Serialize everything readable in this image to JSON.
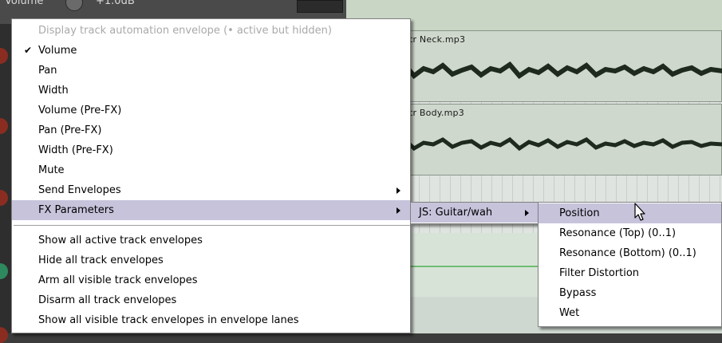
{
  "background": {
    "track": {
      "label": "Volume",
      "value": "+1.0dB"
    },
    "items": [
      {
        "name": "tr Neck.mp3"
      },
      {
        "name": "tr Body.mp3"
      }
    ]
  },
  "main_menu": {
    "header": "Display track automation envelope (• active but hidden)",
    "items": [
      {
        "label": "Volume",
        "checked": true
      },
      {
        "label": "Pan"
      },
      {
        "label": "Width"
      },
      {
        "label": "Volume (Pre-FX)"
      },
      {
        "label": "Pan (Pre-FX)"
      },
      {
        "label": "Width (Pre-FX)"
      },
      {
        "label": "Mute"
      },
      {
        "label": "Send Envelopes",
        "submenu": true
      },
      {
        "label": "FX Parameters",
        "submenu": true,
        "highlighted": true
      }
    ],
    "actions": [
      {
        "label": "Show all active track envelopes"
      },
      {
        "label": "Hide all track envelopes"
      },
      {
        "label": "Arm all visible track envelopes"
      },
      {
        "label": "Disarm all track envelopes"
      },
      {
        "label": "Show all visible track envelopes in envelope lanes"
      }
    ]
  },
  "fx_submenu": {
    "items": [
      {
        "label": "JS: Guitar/wah",
        "submenu": true
      }
    ]
  },
  "param_submenu": {
    "items": [
      {
        "label": "Position",
        "highlighted": true
      },
      {
        "label": "Resonance (Top) (0..1)"
      },
      {
        "label": "Resonance (Bottom) (0..1)"
      },
      {
        "label": "Filter Distortion"
      },
      {
        "label": "Bypass"
      },
      {
        "label": "Wet"
      }
    ]
  },
  "colors": {
    "menu_highlight": "#c6c3db",
    "menu_disabled_text": "#a9a9a9",
    "waveform": "#1e2a1e",
    "envelope": "#4caf50"
  }
}
